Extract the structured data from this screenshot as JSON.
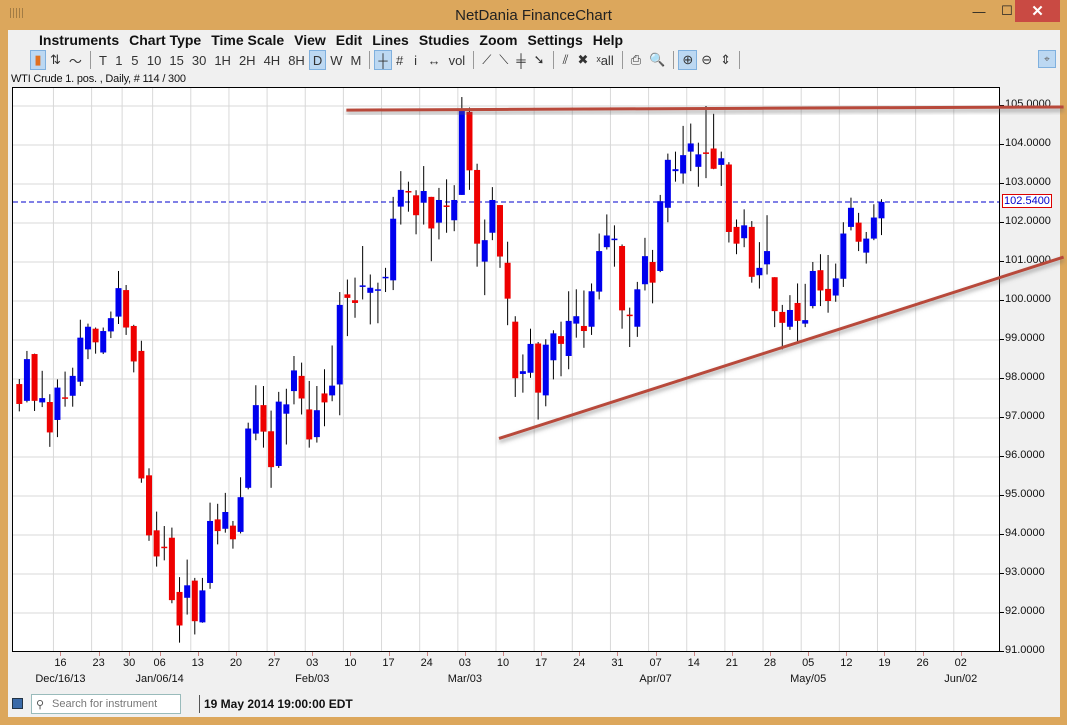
{
  "window": {
    "title": "NetDania FinanceChart",
    "minimize": "—",
    "maximize": "☐",
    "close": "✕"
  },
  "menu": [
    "Instruments",
    "Chart Type",
    "Time Scale",
    "View",
    "Edit",
    "Lines",
    "Studies",
    "Zoom",
    "Settings",
    "Help"
  ],
  "toolbar": {
    "chart_types": [
      {
        "icon": "candlestick-icon",
        "glyph": "▮",
        "selected": true
      },
      {
        "icon": "ohlc-bar-icon",
        "glyph": "⇅",
        "selected": false
      },
      {
        "icon": "line-chart-icon",
        "glyph": "〜",
        "selected": false
      }
    ],
    "time_scales": [
      {
        "label": "T"
      },
      {
        "label": "1"
      },
      {
        "label": "5"
      },
      {
        "label": "10"
      },
      {
        "label": "15"
      },
      {
        "label": "30"
      },
      {
        "label": "1H"
      },
      {
        "label": "2H"
      },
      {
        "label": "4H"
      },
      {
        "label": "8H"
      },
      {
        "label": "D",
        "selected": true
      },
      {
        "label": "W"
      },
      {
        "label": "M"
      }
    ],
    "view_tools": [
      {
        "icon": "crosshair-icon",
        "glyph": "┼",
        "selected": true
      },
      {
        "icon": "grid-icon",
        "glyph": "#"
      },
      {
        "icon": "info-icon",
        "glyph": "i"
      },
      {
        "icon": "scroll-icon",
        "glyph": "↔"
      },
      {
        "icon": "volume-icon",
        "glyph": "vol"
      }
    ],
    "line_tools": [
      {
        "icon": "trend-line-icon",
        "glyph": "⟋"
      },
      {
        "icon": "ray-line-icon",
        "glyph": "⟍"
      },
      {
        "icon": "fibonacci-icon",
        "glyph": "╪"
      },
      {
        "icon": "arrow-line-icon",
        "glyph": "➘"
      }
    ],
    "edit_tools": [
      {
        "icon": "erase-icon",
        "glyph": "⫽"
      },
      {
        "icon": "delete-icon",
        "glyph": "✖"
      },
      {
        "icon": "delete-all-icon",
        "glyph": "ˣall"
      }
    ],
    "print_tools": [
      {
        "icon": "print-icon",
        "glyph": "⎙"
      },
      {
        "icon": "print-preview-icon",
        "glyph": "🔍"
      }
    ],
    "zoom_tools": [
      {
        "icon": "zoom-in-icon",
        "glyph": "⊕",
        "selected": true
      },
      {
        "icon": "zoom-out-icon",
        "glyph": "⊖"
      },
      {
        "icon": "zoom-fit-icon",
        "glyph": "⇕"
      }
    ],
    "pin": "⌖"
  },
  "info_label": "WTI Crude 1. pos. , Daily, # 114 / 300",
  "status": {
    "search_placeholder": "Search for instrument",
    "search_icon": "⚲",
    "datetime": "19 May 2014 19:00:00 EDT"
  },
  "colors": {
    "up": "#0000ee",
    "down": "#ee0000",
    "trendline": "#b84a3a",
    "last_price_line": "#0000cc",
    "frame": "#dca75c",
    "grid": "#d8d8d8"
  },
  "chart_data": {
    "type": "candlestick",
    "instrument": "WTI Crude 1. pos.",
    "interval": "Daily",
    "ylim": [
      91,
      105
    ],
    "y_ticks": [
      "105.0000",
      "104.0000",
      "103.0000",
      "102.0000",
      "101.0000",
      "100.0000",
      "99.0000",
      "98.0000",
      "97.0000",
      "96.0000",
      "95.0000",
      "94.0000",
      "93.0000",
      "92.0000",
      "91.0000"
    ],
    "last_price": "102.5400",
    "grid": true,
    "x_ticks": [
      {
        "label": "16",
        "date": "2013-12-16"
      },
      {
        "label": "23",
        "date": "2013-12-23"
      },
      {
        "label": "30",
        "date": "2013-12-30"
      },
      {
        "label": "06",
        "date": "2014-01-06"
      },
      {
        "label": "13",
        "date": "2014-01-13"
      },
      {
        "label": "20",
        "date": "2014-01-20"
      },
      {
        "label": "27",
        "date": "2014-01-27"
      },
      {
        "label": "03",
        "date": "2014-02-03"
      },
      {
        "label": "10",
        "date": "2014-02-10"
      },
      {
        "label": "17",
        "date": "2014-02-17"
      },
      {
        "label": "24",
        "date": "2014-02-24"
      },
      {
        "label": "03",
        "date": "2014-03-03"
      },
      {
        "label": "10",
        "date": "2014-03-10"
      },
      {
        "label": "17",
        "date": "2014-03-17"
      },
      {
        "label": "24",
        "date": "2014-03-24"
      },
      {
        "label": "31",
        "date": "2014-03-31"
      },
      {
        "label": "07",
        "date": "2014-04-07"
      },
      {
        "label": "14",
        "date": "2014-04-14"
      },
      {
        "label": "21",
        "date": "2014-04-21"
      },
      {
        "label": "28",
        "date": "2014-04-28"
      },
      {
        "label": "05",
        "date": "2014-05-05"
      },
      {
        "label": "12",
        "date": "2014-05-12"
      },
      {
        "label": "19",
        "date": "2014-05-19"
      },
      {
        "label": "26",
        "date": "2014-05-26"
      },
      {
        "label": "02",
        "date": "2014-06-02"
      }
    ],
    "month_labels": [
      {
        "label": "Dec/16/13",
        "date": "2013-12-16"
      },
      {
        "label": "Jan/06/14",
        "date": "2014-01-06"
      },
      {
        "label": "Feb/03",
        "date": "2014-02-03"
      },
      {
        "label": "Mar/03",
        "date": "2014-03-03"
      },
      {
        "label": "Apr/07",
        "date": "2014-04-07"
      },
      {
        "label": "May/05",
        "date": "2014-05-05"
      },
      {
        "label": "Jun/02",
        "date": "2014-06-02"
      }
    ],
    "trendlines": [
      {
        "from": {
          "date": "2014-02-10",
          "value": 104.87
        },
        "to": {
          "date": "2014-06-20",
          "value": 104.95
        }
      },
      {
        "from": {
          "date": "2014-03-10",
          "value": 96.45
        },
        "to": {
          "date": "2014-06-20",
          "value": 101.1
        }
      }
    ],
    "dates": [
      "2013-12-09",
      "2013-12-10",
      "2013-12-11",
      "2013-12-12",
      "2013-12-13",
      "2013-12-16",
      "2013-12-17",
      "2013-12-18",
      "2013-12-19",
      "2013-12-20",
      "2013-12-23",
      "2013-12-24",
      "2013-12-26",
      "2013-12-27",
      "2013-12-30",
      "2013-12-31",
      "2014-01-02",
      "2014-01-03",
      "2014-01-06",
      "2014-01-07",
      "2014-01-08",
      "2014-01-09",
      "2014-01-10",
      "2014-01-13",
      "2014-01-14",
      "2014-01-15",
      "2014-01-16",
      "2014-01-17",
      "2014-01-20",
      "2014-01-21",
      "2014-01-22",
      "2014-01-23",
      "2014-01-24",
      "2014-01-27",
      "2014-01-28",
      "2014-01-29",
      "2014-01-30",
      "2014-01-31",
      "2014-02-03",
      "2014-02-04",
      "2014-02-05",
      "2014-02-06",
      "2014-02-07",
      "2014-02-10",
      "2014-02-11",
      "2014-02-12",
      "2014-02-13",
      "2014-02-14",
      "2014-02-17",
      "2014-02-18",
      "2014-02-19",
      "2014-02-20",
      "2014-02-21",
      "2014-02-24",
      "2014-02-25",
      "2014-02-26",
      "2014-02-27",
      "2014-02-28",
      "2014-03-03",
      "2014-03-04",
      "2014-03-05",
      "2014-03-06",
      "2014-03-07",
      "2014-03-10",
      "2014-03-11",
      "2014-03-12",
      "2014-03-13",
      "2014-03-14",
      "2014-03-17",
      "2014-03-18",
      "2014-03-19",
      "2014-03-20",
      "2014-03-21",
      "2014-03-24",
      "2014-03-25",
      "2014-03-26",
      "2014-03-27",
      "2014-03-28",
      "2014-03-31",
      "2014-04-01",
      "2014-04-02",
      "2014-04-03",
      "2014-04-04",
      "2014-04-07",
      "2014-04-08",
      "2014-04-09",
      "2014-04-10",
      "2014-04-11",
      "2014-04-14",
      "2014-04-15",
      "2014-04-16",
      "2014-04-17",
      "2014-04-18",
      "2014-04-21",
      "2014-04-22",
      "2014-04-23",
      "2014-04-24",
      "2014-04-25",
      "2014-04-28",
      "2014-04-29",
      "2014-04-30",
      "2014-05-01",
      "2014-05-02",
      "2014-05-05",
      "2014-05-06",
      "2014-05-07",
      "2014-05-08",
      "2014-05-09",
      "2014-05-12",
      "2014-05-13",
      "2014-05-14",
      "2014-05-15",
      "2014-05-16",
      "2014-05-19"
    ],
    "ohlc_columns": [
      "open",
      "high",
      "low",
      "close"
    ],
    "ohlc": [
      [
        97.87,
        98.0,
        97.17,
        97.36
      ],
      [
        97.44,
        98.72,
        97.4,
        98.51
      ],
      [
        98.64,
        98.65,
        97.18,
        97.44
      ],
      [
        97.4,
        98.21,
        97.28,
        97.51
      ],
      [
        97.41,
        97.61,
        96.26,
        96.63
      ],
      [
        96.95,
        97.99,
        96.51,
        97.78
      ],
      [
        97.53,
        98.19,
        97.29,
        97.5
      ],
      [
        97.57,
        98.29,
        97.29,
        98.08
      ],
      [
        97.93,
        99.52,
        97.82,
        99.06
      ],
      [
        98.76,
        99.42,
        98.51,
        99.34
      ],
      [
        99.29,
        99.32,
        98.65,
        98.94
      ],
      [
        98.68,
        99.32,
        98.64,
        99.23
      ],
      [
        99.22,
        99.73,
        99.05,
        99.56
      ],
      [
        99.6,
        100.77,
        99.41,
        100.33
      ],
      [
        100.28,
        100.41,
        99.13,
        99.32
      ],
      [
        99.36,
        99.39,
        98.17,
        98.45
      ],
      [
        98.72,
        98.98,
        95.34,
        95.45
      ],
      [
        95.53,
        95.71,
        93.85,
        93.99
      ],
      [
        94.12,
        94.6,
        93.19,
        93.45
      ],
      [
        93.7,
        94.23,
        93.35,
        93.67
      ],
      [
        93.93,
        94.19,
        92.25,
        92.33
      ],
      [
        92.54,
        92.92,
        91.24,
        91.68
      ],
      [
        92.39,
        93.37,
        91.96,
        92.71
      ],
      [
        92.83,
        92.9,
        91.45,
        91.79
      ],
      [
        91.76,
        92.9,
        91.75,
        92.58
      ],
      [
        92.77,
        94.83,
        92.62,
        94.36
      ],
      [
        94.4,
        94.8,
        93.76,
        94.1
      ],
      [
        94.16,
        95.08,
        94.06,
        94.59
      ],
      [
        94.24,
        94.36,
        93.65,
        93.89
      ],
      [
        94.08,
        95.48,
        94.04,
        94.97
      ],
      [
        95.21,
        96.88,
        95.17,
        96.73
      ],
      [
        96.6,
        97.84,
        96.43,
        97.33
      ],
      [
        97.33,
        97.82,
        96.24,
        96.65
      ],
      [
        96.66,
        97.19,
        95.21,
        95.74
      ],
      [
        95.77,
        97.67,
        95.72,
        97.42
      ],
      [
        97.11,
        97.75,
        96.32,
        97.35
      ],
      [
        97.69,
        98.59,
        97.35,
        98.22
      ],
      [
        98.08,
        98.42,
        97.09,
        97.5
      ],
      [
        97.22,
        97.95,
        96.24,
        96.45
      ],
      [
        96.51,
        97.82,
        96.37,
        97.2
      ],
      [
        97.63,
        98.25,
        96.79,
        97.4
      ],
      [
        97.58,
        98.86,
        97.43,
        97.83
      ],
      [
        97.86,
        100.23,
        97.07,
        99.9
      ],
      [
        100.17,
        100.55,
        99.1,
        100.08
      ],
      [
        100.02,
        100.6,
        99.57,
        99.95
      ],
      [
        100.38,
        101.41,
        100.04,
        100.4
      ],
      [
        100.21,
        100.68,
        99.4,
        100.34
      ],
      [
        100.27,
        100.47,
        99.43,
        100.3
      ],
      [
        100.6,
        100.85,
        100.23,
        100.62
      ],
      [
        100.53,
        102.67,
        100.28,
        102.11
      ],
      [
        102.42,
        103.33,
        101.96,
        102.85
      ],
      [
        102.82,
        103.06,
        102.29,
        102.8
      ],
      [
        102.71,
        102.84,
        101.71,
        102.2
      ],
      [
        102.52,
        103.46,
        101.96,
        102.82
      ],
      [
        102.67,
        102.67,
        101.02,
        101.86
      ],
      [
        102.01,
        102.9,
        101.58,
        102.59
      ],
      [
        102.45,
        103.12,
        101.75,
        102.43
      ],
      [
        102.07,
        102.97,
        101.79,
        102.59
      ],
      [
        102.72,
        105.23,
        102.72,
        104.91
      ],
      [
        104.85,
        104.96,
        102.85,
        103.35
      ],
      [
        103.36,
        103.52,
        100.88,
        101.47
      ],
      [
        101.01,
        102.09,
        100.15,
        101.56
      ],
      [
        101.75,
        102.92,
        101.56,
        102.59
      ],
      [
        102.46,
        102.46,
        100.85,
        101.14
      ],
      [
        100.98,
        101.52,
        99.38,
        100.06
      ],
      [
        99.47,
        99.61,
        97.54,
        98.02
      ],
      [
        98.13,
        98.63,
        97.65,
        98.2
      ],
      [
        98.16,
        99.29,
        98.03,
        98.9
      ],
      [
        98.91,
        98.95,
        96.96,
        97.65
      ],
      [
        97.58,
        99.02,
        97.3,
        98.88
      ],
      [
        98.48,
        99.25,
        97.99,
        99.17
      ],
      [
        99.1,
        99.47,
        98.07,
        98.9
      ],
      [
        98.59,
        100.25,
        98.25,
        99.49
      ],
      [
        99.42,
        100.3,
        99.06,
        99.61
      ],
      [
        99.36,
        100.27,
        98.8,
        99.23
      ],
      [
        99.34,
        100.45,
        99.13,
        100.25
      ],
      [
        100.24,
        101.73,
        100.04,
        101.28
      ],
      [
        101.38,
        102.22,
        101.32,
        101.68
      ],
      [
        101.56,
        101.94,
        100.88,
        101.6
      ],
      [
        101.41,
        101.45,
        99.29,
        99.76
      ],
      [
        99.65,
        99.83,
        98.82,
        99.64
      ],
      [
        99.34,
        100.49,
        99.08,
        100.3
      ],
      [
        100.43,
        101.62,
        100.27,
        101.15
      ],
      [
        101.0,
        101.31,
        99.94,
        100.47
      ],
      [
        100.77,
        102.72,
        100.74,
        102.56
      ],
      [
        102.39,
        103.78,
        102.02,
        103.62
      ],
      [
        103.33,
        103.83,
        103.06,
        103.38
      ],
      [
        103.27,
        104.49,
        103.01,
        103.74
      ],
      [
        103.83,
        104.55,
        103.33,
        104.04
      ],
      [
        103.44,
        104.06,
        102.93,
        103.76
      ],
      [
        103.81,
        105.0,
        103.15,
        103.79
      ],
      [
        103.91,
        104.8,
        103.38,
        103.39
      ],
      [
        103.49,
        103.83,
        102.95,
        103.66
      ],
      [
        103.5,
        103.56,
        101.5,
        101.77
      ],
      [
        101.9,
        102.09,
        101.2,
        101.47
      ],
      [
        101.61,
        102.35,
        101.38,
        101.94
      ],
      [
        101.9,
        102.05,
        100.47,
        100.62
      ],
      [
        100.66,
        101.51,
        100.32,
        100.85
      ],
      [
        100.94,
        102.2,
        100.68,
        101.28
      ],
      [
        100.61,
        100.61,
        99.33,
        99.74
      ],
      [
        99.72,
        99.9,
        98.76,
        99.44
      ],
      [
        99.34,
        100.15,
        99.26,
        99.77
      ],
      [
        99.95,
        100.45,
        98.9,
        99.49
      ],
      [
        99.42,
        100.44,
        99.33,
        99.51
      ],
      [
        99.87,
        101.0,
        99.81,
        100.77
      ],
      [
        100.79,
        101.2,
        99.87,
        100.27
      ],
      [
        100.31,
        101.18,
        99.7,
        100.0
      ],
      [
        100.14,
        100.96,
        99.98,
        100.58
      ],
      [
        100.57,
        102.02,
        100.36,
        101.73
      ],
      [
        101.9,
        102.65,
        101.81,
        102.39
      ],
      [
        102.01,
        102.26,
        101.28,
        101.52
      ],
      [
        101.24,
        101.77,
        100.96,
        101.6
      ],
      [
        101.6,
        102.48,
        101.56,
        102.14
      ],
      [
        102.12,
        102.61,
        101.69,
        102.54
      ]
    ]
  }
}
